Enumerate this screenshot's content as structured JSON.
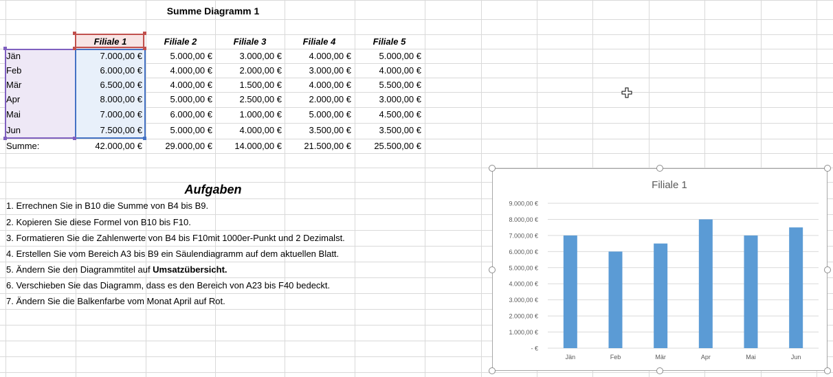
{
  "sheet_title": "Summe Diagramm 1",
  "table": {
    "headers": [
      "Filiale 1",
      "Filiale 2",
      "Filiale 3",
      "Filiale 4",
      "Filiale 5"
    ],
    "rows": [
      {
        "month": "Jän",
        "values": [
          "7.000,00 €",
          "5.000,00 €",
          "3.000,00 €",
          "4.000,00 €",
          "5.000,00 €"
        ]
      },
      {
        "month": "Feb",
        "values": [
          "6.000,00 €",
          "4.000,00 €",
          "2.000,00 €",
          "3.000,00 €",
          "4.000,00 €"
        ]
      },
      {
        "month": "Mär",
        "values": [
          "6.500,00 €",
          "4.000,00 €",
          "1.500,00 €",
          "4.000,00 €",
          "5.500,00 €"
        ]
      },
      {
        "month": "Apr",
        "values": [
          "8.000,00 €",
          "5.000,00 €",
          "2.500,00 €",
          "2.000,00 €",
          "3.000,00 €"
        ]
      },
      {
        "month": "Mai",
        "values": [
          "7.000,00 €",
          "6.000,00 €",
          "1.000,00 €",
          "5.000,00 €",
          "4.500,00 €"
        ]
      },
      {
        "month": "Jun",
        "values": [
          "7.500,00 €",
          "5.000,00 €",
          "4.000,00 €",
          "3.500,00 €",
          "3.500,00 €"
        ]
      }
    ],
    "sum_label": "Summe:",
    "sums": [
      "42.000,00 €",
      "29.000,00 €",
      "14.000,00 €",
      "21.500,00 €",
      "25.500,00 €"
    ]
  },
  "tasks": {
    "title": "Aufgaben",
    "items": [
      {
        "text": "1. Errechnen Sie in B10 die Summe von B4 bis B9."
      },
      {
        "text": "2. Kopieren Sie diese Formel von B10 bis F10."
      },
      {
        "text": "3. Formatieren Sie die Zahlenwerte von B4 bis F10mit 1000er-Punkt und 2 Dezimalst."
      },
      {
        "text": "4. Erstellen Sie vom Bereich A3 bis B9 ein Säulendiagramm auf dem aktuellen Blatt."
      },
      {
        "text": "5. Ändern Sie den Diagrammtitel auf ",
        "bold": "Umsatzübersicht."
      },
      {
        "text": "6. Verschieben Sie das Diagramm, dass es den Bereich von A23 bis F40 bedeckt."
      },
      {
        "text": "7. Ändern Sie die Balkenfarbe vom Monat April auf Rot."
      }
    ]
  },
  "cursor_icon": "cross-move-cursor-icon",
  "colors": {
    "bar": "#5b9bd5",
    "selected_header_fill": "#f8e4e4",
    "selected_header_border": "#c0504d",
    "selection_values_fill": "#e8f0fa",
    "selection_values_border": "#4472c4",
    "selection_labels_fill": "#eee8f6",
    "selection_labels_border": "#7f5fbf"
  },
  "chart_data": {
    "type": "bar",
    "title": "Filiale 1",
    "categories": [
      "Jän",
      "Feb",
      "Mär",
      "Apr",
      "Mai",
      "Jun"
    ],
    "values": [
      7000,
      6000,
      6500,
      8000,
      7000,
      7500
    ],
    "ylim": [
      0,
      9000
    ],
    "yticks": [
      "-  €",
      "1.000,00 €",
      "2.000,00 €",
      "3.000,00 €",
      "4.000,00 €",
      "5.000,00 €",
      "6.000,00 €",
      "7.000,00 €",
      "8.000,00 €",
      "9.000,00 €"
    ],
    "grid": true,
    "legend": "none"
  }
}
